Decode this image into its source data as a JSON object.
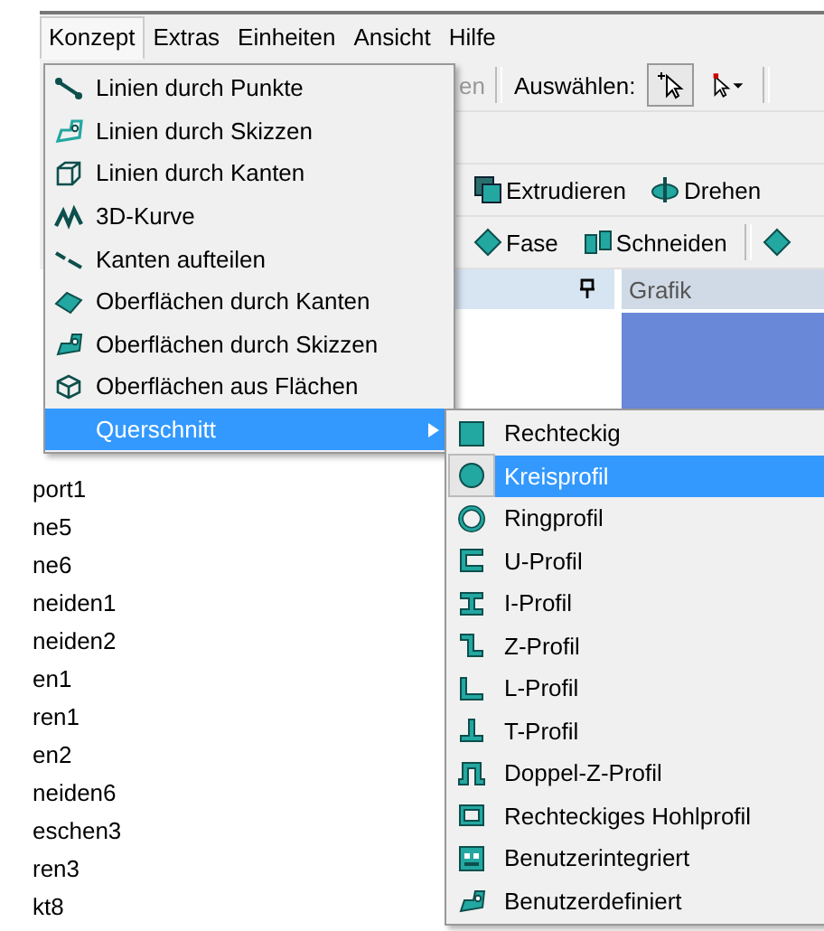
{
  "menubar": [
    {
      "label": "Konzept",
      "selected": true
    },
    {
      "label": "Extras",
      "selected": false
    },
    {
      "label": "Einheiten",
      "selected": false
    },
    {
      "label": "Ansicht",
      "selected": false
    },
    {
      "label": "Hilfe",
      "selected": false
    }
  ],
  "toolbar": {
    "cut_label": "en",
    "select_label": "Auswählen:",
    "rows": [
      [
        {
          "label": "Extrudieren"
        },
        {
          "label": "Drehen"
        }
      ],
      [
        {
          "label": "Fase"
        },
        {
          "label": "Schneiden"
        }
      ]
    ]
  },
  "tree_panel": {
    "items": [
      "port1",
      "ne5",
      "ne6",
      "neiden1",
      "neiden2",
      "en1",
      "ren1",
      "en2",
      "neiden6",
      "eschen3",
      "ren3",
      "kt8"
    ]
  },
  "graphics_panel": {
    "title": "Grafik"
  },
  "menu": {
    "items": [
      {
        "label": "Linien durch Punkte",
        "kind": "item",
        "selected": false
      },
      {
        "label": "Linien durch Skizzen",
        "kind": "item",
        "selected": false
      },
      {
        "label": "Linien durch Kanten",
        "kind": "item",
        "selected": false
      },
      {
        "label": "3D-Kurve",
        "kind": "item",
        "selected": false
      },
      {
        "label": "Kanten aufteilen",
        "kind": "item",
        "selected": false
      },
      {
        "label": "Oberflächen durch Kanten",
        "kind": "item",
        "selected": false
      },
      {
        "label": "Oberflächen durch Skizzen",
        "kind": "item",
        "selected": false
      },
      {
        "label": "Oberflächen aus Flächen",
        "kind": "item",
        "selected": false
      },
      {
        "label": "Querschnitt",
        "kind": "submenu",
        "selected": true
      }
    ]
  },
  "submenu": {
    "items": [
      {
        "label": "Rechteckig",
        "selected": false
      },
      {
        "label": "Kreisprofil",
        "selected": true
      },
      {
        "label": "Ringprofil",
        "selected": false
      },
      {
        "label": "U-Profil",
        "selected": false
      },
      {
        "label": "I-Profil",
        "selected": false
      },
      {
        "label": "Z-Profil",
        "selected": false
      },
      {
        "label": "L-Profil",
        "selected": false
      },
      {
        "label": "T-Profil",
        "selected": false
      },
      {
        "label": "Doppel-Z-Profil",
        "selected": false
      },
      {
        "label": "Rechteckiges Hohlprofil",
        "selected": false
      },
      {
        "label": "Benutzerintegriert",
        "selected": false
      },
      {
        "label": "Benutzerdefiniert",
        "selected": false
      }
    ]
  }
}
